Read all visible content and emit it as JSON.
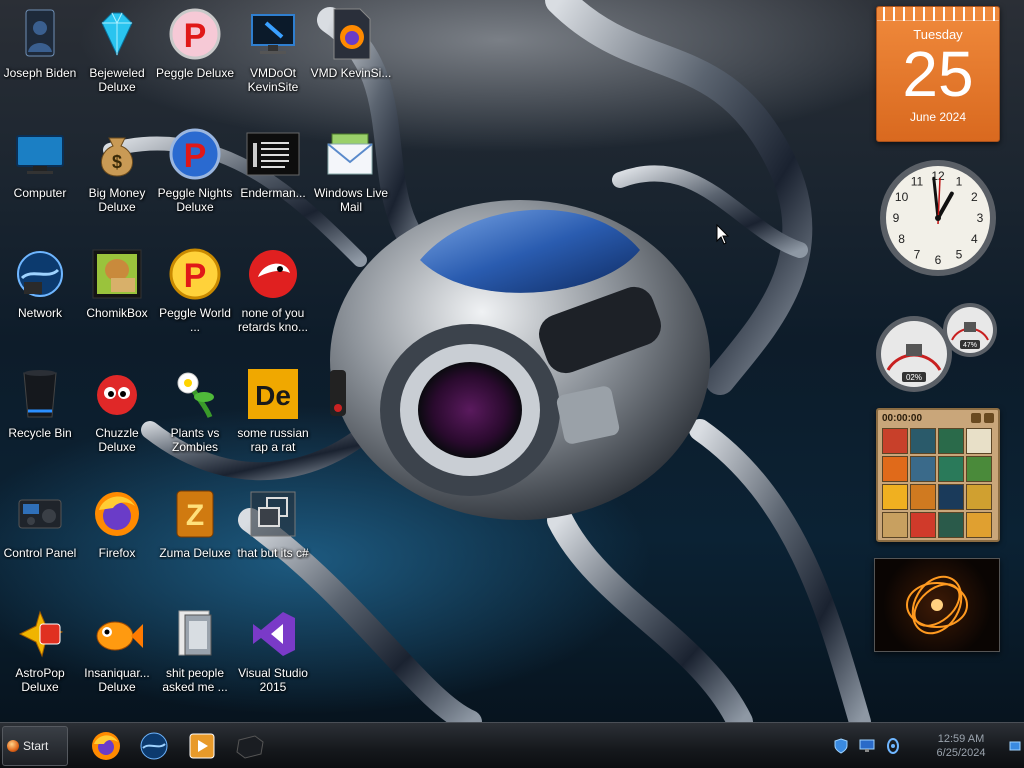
{
  "desktop": {
    "icons": [
      {
        "label": "Joseph Biden",
        "icon": "user-folder-icon"
      },
      {
        "label": "Bejeweled Deluxe",
        "icon": "diamond-icon"
      },
      {
        "label": "Peggle Deluxe",
        "icon": "peggle-icon"
      },
      {
        "label": "VMDoOt KevinSite",
        "icon": "monitor-icon"
      },
      {
        "label": "VMD KevinSi...",
        "icon": "firefox-file-icon"
      },
      {
        "label": "Computer",
        "icon": "computer-icon"
      },
      {
        "label": "Big Money Deluxe",
        "icon": "money-bag-icon"
      },
      {
        "label": "Peggle Nights Deluxe",
        "icon": "peggle-nights-icon"
      },
      {
        "label": "Enderman...",
        "icon": "text-window-icon"
      },
      {
        "label": "Windows Live Mail",
        "icon": "mail-icon"
      },
      {
        "label": "Network",
        "icon": "network-globe-icon"
      },
      {
        "label": "ChomikBox",
        "icon": "hamster-box-icon"
      },
      {
        "label": "Peggle World ...",
        "icon": "peggle-world-icon"
      },
      {
        "label": "none of you retards kno...",
        "icon": "red-creature-icon"
      },
      {
        "label": "Recycle Bin",
        "icon": "recycle-bin-icon"
      },
      {
        "label": "Chuzzle Deluxe",
        "icon": "chuzzle-icon"
      },
      {
        "label": "Plants vs Zombies",
        "icon": "flower-icon"
      },
      {
        "label": "some russian rap a rat",
        "icon": "de-icon"
      },
      {
        "label": "Control Panel",
        "icon": "control-panel-icon"
      },
      {
        "label": "Firefox",
        "icon": "firefox-icon"
      },
      {
        "label": "Zuma Deluxe",
        "icon": "zuma-icon"
      },
      {
        "label": "that but its c#",
        "icon": "windows-stack-icon"
      },
      {
        "label": "AstroPop Deluxe",
        "icon": "astropop-icon"
      },
      {
        "label": "Insaniquar... Deluxe",
        "icon": "goldfish-icon"
      },
      {
        "label": "shit people asked me ...",
        "icon": "file-folder-icon"
      },
      {
        "label": "Visual Studio 2015",
        "icon": "visual-studio-icon"
      }
    ]
  },
  "gadgets": {
    "calendar": {
      "weekday": "Tuesday",
      "day": "25",
      "month_year": "June 2024"
    },
    "clock": {
      "hour": 12,
      "minute": 59
    },
    "meters": {
      "cpu_percent": "02%",
      "memory_percent": "47%"
    },
    "puzzle": {
      "timer": "00:00:00"
    }
  },
  "taskbar": {
    "start_label": "Start",
    "pinned": [
      {
        "icon": "firefox-icon"
      },
      {
        "icon": "globe-icon"
      },
      {
        "icon": "media-player-icon"
      },
      {
        "icon": "hardware-icon"
      }
    ],
    "tray": [
      {
        "icon": "security-shield-icon"
      },
      {
        "icon": "network-icon"
      },
      {
        "icon": "volume-icon"
      }
    ],
    "time": "12:59 AM",
    "date": "6/25/2024"
  }
}
